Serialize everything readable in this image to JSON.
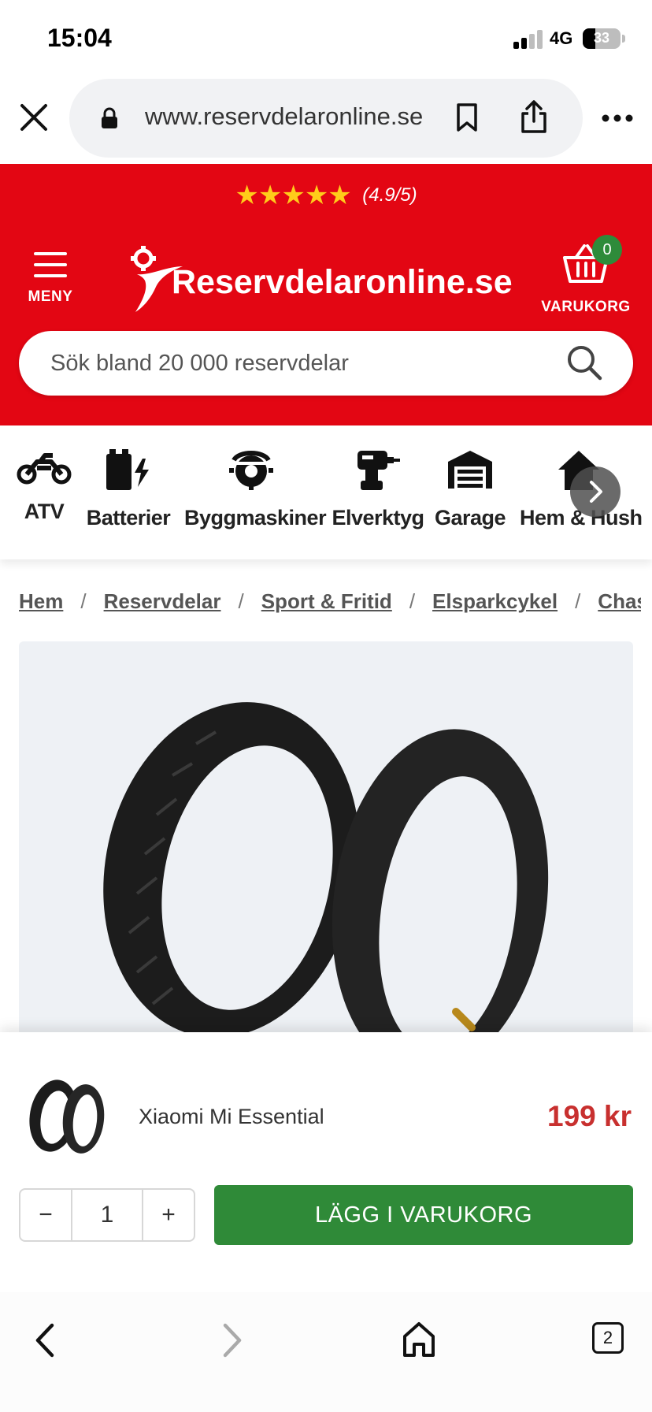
{
  "status_bar": {
    "time": "15:04",
    "network": "4G",
    "battery": "33"
  },
  "browser": {
    "url": "www.reservdelaronline.se",
    "tabs_count": "2"
  },
  "header": {
    "stars": "★★★★★",
    "rating_text": "(4.9/5)",
    "menu_label": "MENY",
    "logo_text": "Reservdelaronline.se",
    "cart_label": "VARUKORG",
    "cart_count": "0",
    "search_placeholder": "Sök bland 20 000 reservdelar"
  },
  "categories": [
    {
      "label": "ATV",
      "icon": "motorcycle-icon"
    },
    {
      "label": "Batterier",
      "icon": "battery-icon"
    },
    {
      "label": "Byggmaskiner",
      "icon": "saw-blade-icon"
    },
    {
      "label": "Elverktyg",
      "icon": "drill-icon"
    },
    {
      "label": "Garage",
      "icon": "garage-icon"
    },
    {
      "label": "Hem & Hush",
      "icon": "house-icon"
    }
  ],
  "breadcrumb": [
    "Hem",
    "Reservdelar",
    "Sport & Fritid",
    "Elsparkcykel",
    "Chassi"
  ],
  "product": {
    "name": "Xiaomi Mi Essential",
    "price": "199 kr",
    "quantity": "1",
    "minus_label": "−",
    "plus_label": "+",
    "add_to_cart_label": "LÄGG I VARUKORG"
  },
  "colors": {
    "brand_red": "#e30613",
    "buy_green": "#2f8a38",
    "price_red": "#c8302f",
    "star_yellow": "#ffcc1a"
  }
}
